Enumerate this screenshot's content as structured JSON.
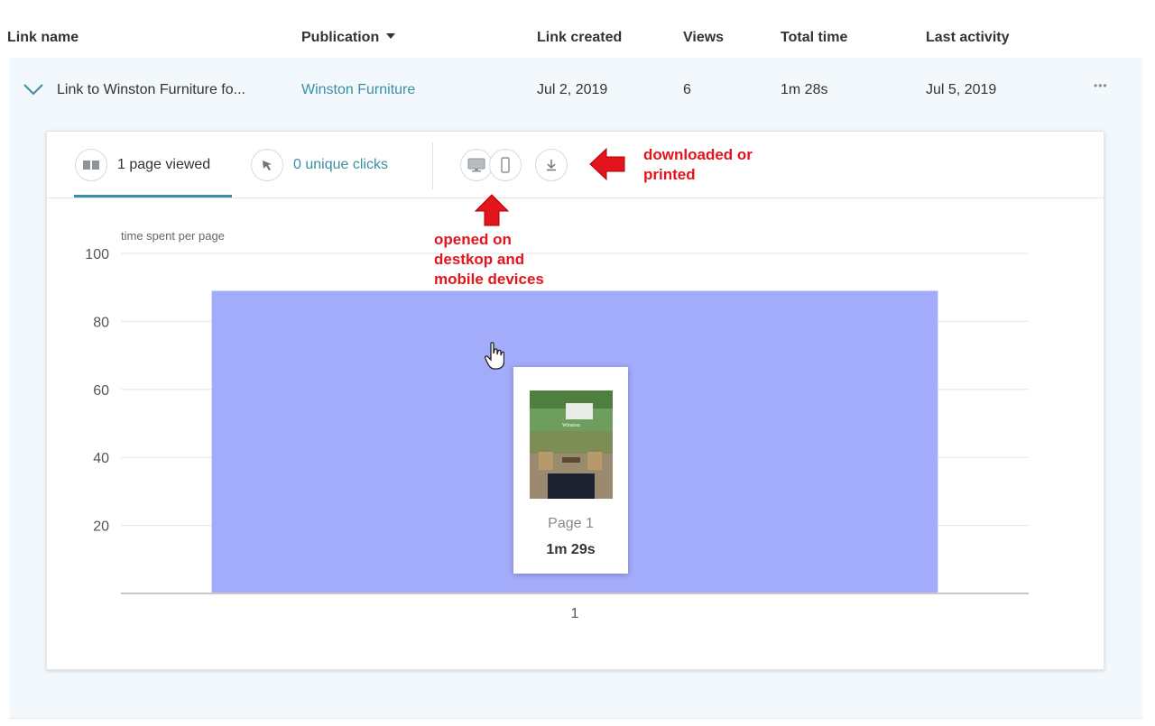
{
  "table": {
    "headers": {
      "link_name": "Link name",
      "publication": "Publication",
      "link_created": "Link created",
      "views": "Views",
      "total_time": "Total time",
      "last_activity": "Last activity"
    },
    "row": {
      "link_name": "Link to Winston Furniture fo...",
      "publication": "Winston Furniture",
      "link_created": "Jul 2, 2019",
      "views": "6",
      "total_time": "1m 28s",
      "last_activity": "Jul 5, 2019",
      "more_glyph": "•••"
    }
  },
  "detail": {
    "tabs": {
      "pages_viewed": "1 page viewed",
      "unique_clicks": "0 unique clicks"
    },
    "tooltip": {
      "page": "Page 1",
      "time": "1m 29s"
    }
  },
  "annotations": {
    "downloaded_line1": "downloaded or",
    "downloaded_line2": "printed",
    "opened_line1": "opened on",
    "opened_line2": "destkop and",
    "opened_line3": "mobile devices"
  },
  "colors": {
    "accent": "#3a8fa5",
    "bar": "#a3abfb",
    "annotation": "#e3141b",
    "row_background": "#f2f8fb"
  },
  "chart_data": {
    "type": "bar",
    "title": "time spent per page",
    "categories": [
      "1"
    ],
    "values": [
      89
    ],
    "ylim": [
      0,
      100
    ],
    "yticks": [
      20,
      40,
      60,
      80,
      100
    ],
    "grid": true,
    "xlabel": "",
    "ylabel": ""
  }
}
